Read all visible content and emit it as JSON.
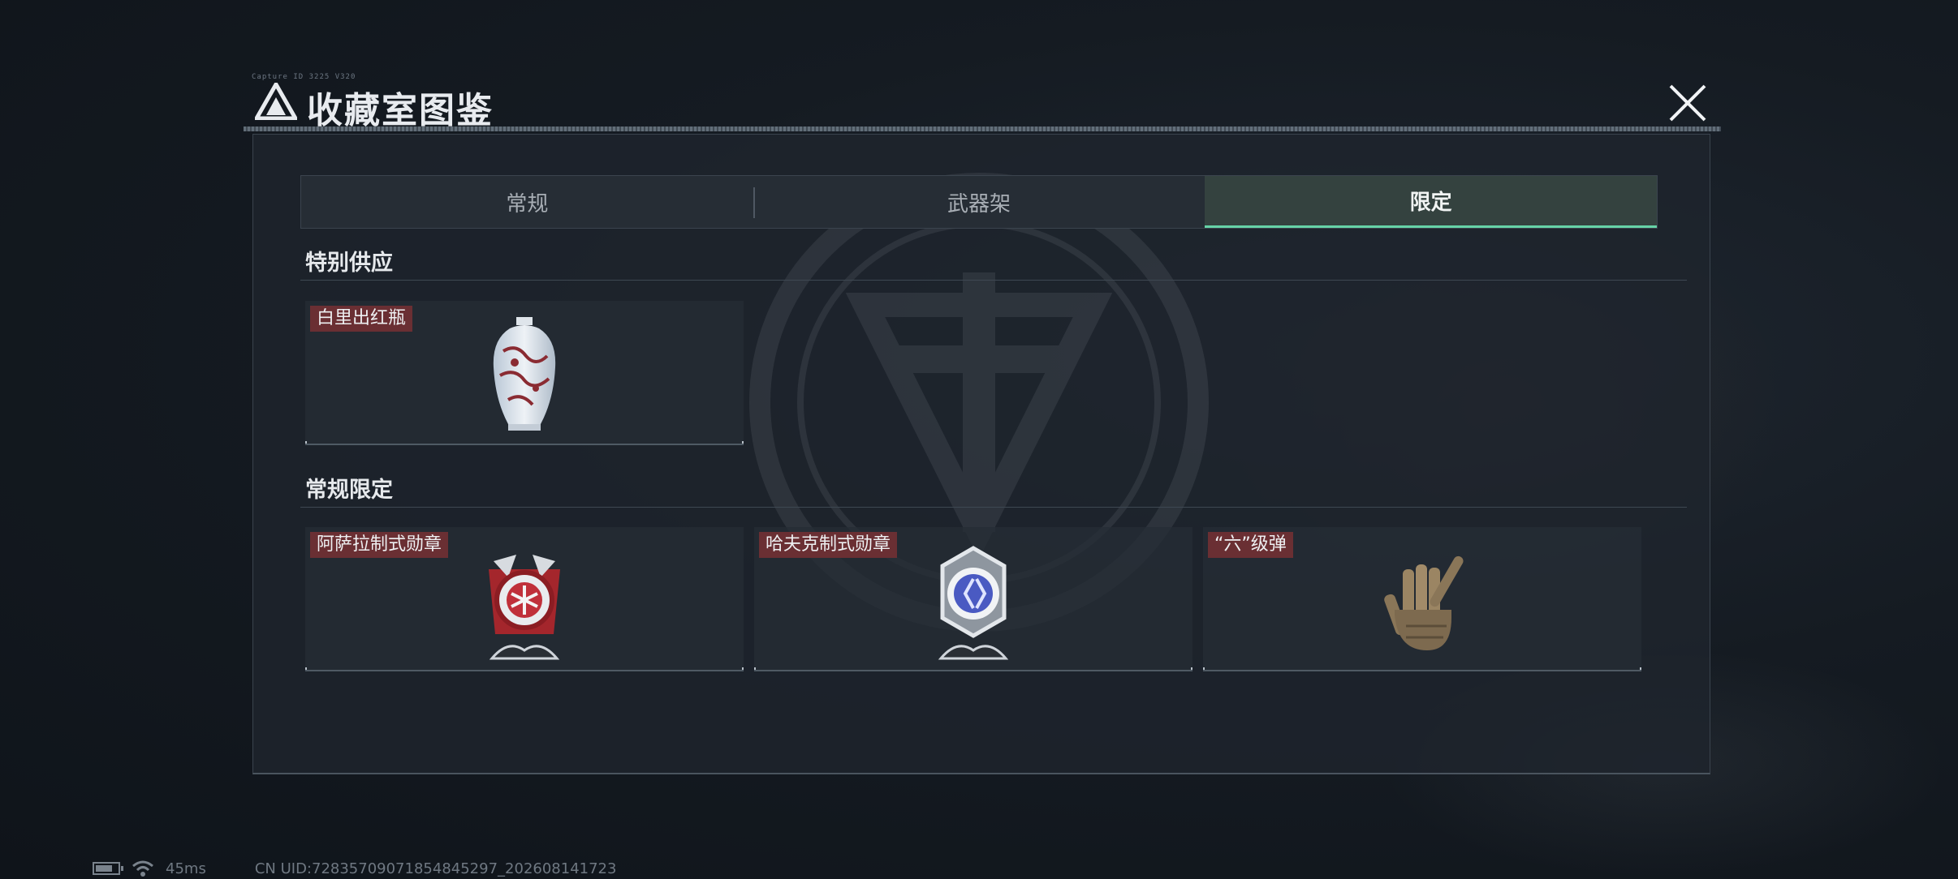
{
  "header": {
    "tiny_text": "Capture ID 3225 V320",
    "title": "收藏室图鉴",
    "close_icon": "close-icon"
  },
  "tabs": [
    {
      "label": "常规",
      "active": false
    },
    {
      "label": "武器架",
      "active": false
    },
    {
      "label": "限定",
      "active": true
    }
  ],
  "sections": [
    {
      "title": "特别供应",
      "items": [
        {
          "label": "白里出红瓶",
          "icon": "vase-icon"
        }
      ]
    },
    {
      "title": "常规限定",
      "items": [
        {
          "label": "阿萨拉制式勋章",
          "icon": "red-medal-icon"
        },
        {
          "label": "哈夫克制式勋章",
          "icon": "blue-medal-icon"
        },
        {
          "label": "“六”级弹",
          "icon": "bullet-hand-icon"
        }
      ]
    }
  ],
  "status": {
    "ping": "45ms",
    "uid": "CN UID:728357090718548452​97_202608141723"
  },
  "colors": {
    "accent": "#66d3a7",
    "label_bg": "#6a2f33",
    "panel_bg": "#1e252d"
  }
}
